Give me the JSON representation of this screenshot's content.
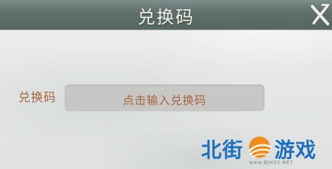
{
  "dialog": {
    "title": "兑换码",
    "close_icon": "close-x-icon",
    "field_label": "兑换码",
    "input_placeholder": "点击输入兑换码"
  },
  "watermark": {
    "text_left": "北街",
    "text_right": "游戏",
    "logo_icon": "sun-wave-logo-icon",
    "url": "www.BJHXS.NET"
  },
  "colors": {
    "title_bar": "#5f6f6b",
    "title_text": "#f4f2e8",
    "label_text": "#a7643c",
    "input_bg": "#c4c4c2",
    "watermark_blue": "#1d6fbf",
    "watermark_orange": "#f28a1c"
  }
}
